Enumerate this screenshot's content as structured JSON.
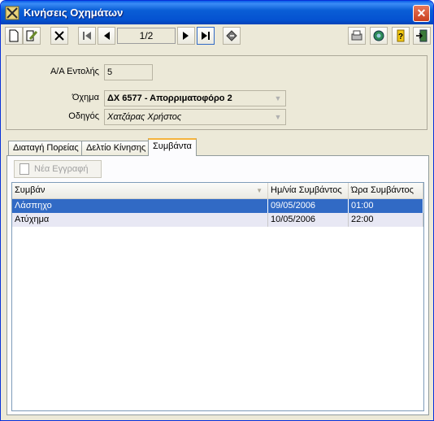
{
  "window": {
    "title": "Κινήσεις Οχημάτων",
    "close_label": "✕"
  },
  "toolbar": {
    "pager_text": "1/2"
  },
  "form": {
    "order_label": "Α/Α Εντολής",
    "order_value": "5",
    "vehicle_label": "Όχημα",
    "vehicle_value": "ΔΧ 6577 - Απορριματοφόρο 2",
    "driver_label": "Οδηγός",
    "driver_value": "Χατζάρας Χρήστος"
  },
  "tabs": [
    {
      "label": "Διαταγή Πορείας"
    },
    {
      "label": "Δελτίο Κίνησης"
    },
    {
      "label": "Συμβάντα"
    }
  ],
  "events": {
    "new_button_label": "Νέα Εγγραφή",
    "columns": [
      "Συμβάν",
      "Ημ/νία Συμβάντος",
      "Ώρα Συμβάντος"
    ],
    "rows": [
      {
        "event": "Λάσπηχο",
        "date": "09/05/2006",
        "time": "01:00"
      },
      {
        "event": "Ατύχημα",
        "date": "10/05/2006",
        "time": "22:00"
      }
    ]
  },
  "colors": {
    "title_bar": "#0552d1",
    "selected_row": "#316ac5",
    "alt_row": "#e8e8f4",
    "active_tab_accent": "#f5b33c"
  },
  "icons": [
    "app-icon",
    "new-doc-icon",
    "edit-icon",
    "delete-icon",
    "first-record-icon",
    "prev-record-icon",
    "next-record-icon",
    "last-record-icon",
    "refresh-icon",
    "print-icon",
    "preview-icon",
    "help-icon",
    "exit-icon"
  ]
}
